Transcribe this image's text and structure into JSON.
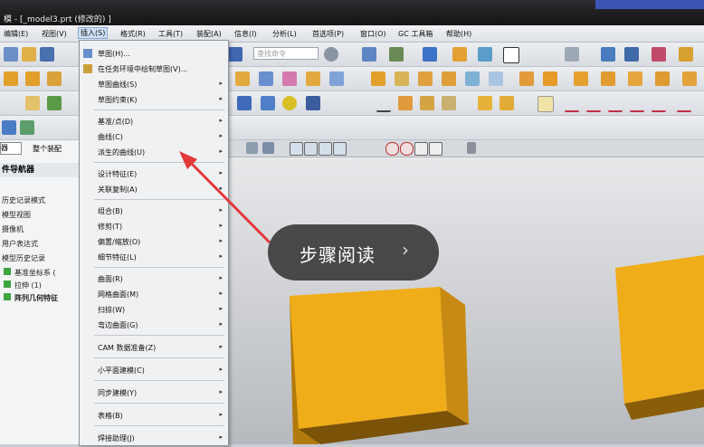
{
  "window": {
    "title": "模 - [_model3.prt (修改的) ]"
  },
  "menubar": {
    "items": [
      "编辑(E)",
      "视图(V)",
      "插入(S)",
      "格式(R)",
      "工具(T)",
      "装配(A)",
      "信息(I)",
      "分析(L)",
      "首选项(P)",
      "窗口(O)",
      "GC 工具箱",
      "帮助(H)"
    ]
  },
  "toolbar": {
    "search_placeholder": "查找命令"
  },
  "left_panel": {
    "selector": "器",
    "filter": "整个装配",
    "title": "件导航器",
    "items": [
      "历史记录模式",
      "模型视图",
      "摄像机",
      "用户表达式",
      "模型历史记录",
      "基准坐标系 (",
      "拉伸 (1)",
      "阵列几何特征"
    ]
  },
  "insert_menu": {
    "items": [
      {
        "label": "草图(H)...",
        "arrow": false
      },
      {
        "label": "在任务环境中绘制草图(V)...",
        "arrow": false
      },
      {
        "label": "草图曲线(S)",
        "arrow": true
      },
      {
        "label": "草图约束(K)",
        "arrow": true
      },
      {
        "label": "基准/点(D)",
        "arrow": true
      },
      {
        "label": "曲线(C)",
        "arrow": true
      },
      {
        "label": "派生的曲线(U)",
        "arrow": true
      },
      {
        "label": "设计特征(E)",
        "arrow": true
      },
      {
        "label": "关联复制(A)",
        "arrow": true
      },
      {
        "label": "组合(B)",
        "arrow": true
      },
      {
        "label": "修剪(T)",
        "arrow": true
      },
      {
        "label": "偏置/缩放(O)",
        "arrow": true
      },
      {
        "label": "细节特征(L)",
        "arrow": true
      },
      {
        "label": "曲面(R)",
        "arrow": true
      },
      {
        "label": "网格曲面(M)",
        "arrow": true
      },
      {
        "label": "扫掠(W)",
        "arrow": true
      },
      {
        "label": "弯边曲面(G)",
        "arrow": true
      },
      {
        "label": "CAM 数据准备(Z)",
        "arrow": true
      },
      {
        "label": "小平面建模(C)",
        "arrow": true
      },
      {
        "label": "同步建模(Y)",
        "arrow": true
      },
      {
        "label": "表格(B)",
        "arrow": true
      },
      {
        "label": "焊接助理(J)",
        "arrow": true
      }
    ]
  },
  "overlay": {
    "text": "步骤阅读",
    "chevron": "›"
  },
  "colors": {
    "cube_front": "#f0ad1a",
    "cube_side": "#b27a0c",
    "cube_top": "#f5c04a",
    "title_bar": "#1e1e20"
  }
}
